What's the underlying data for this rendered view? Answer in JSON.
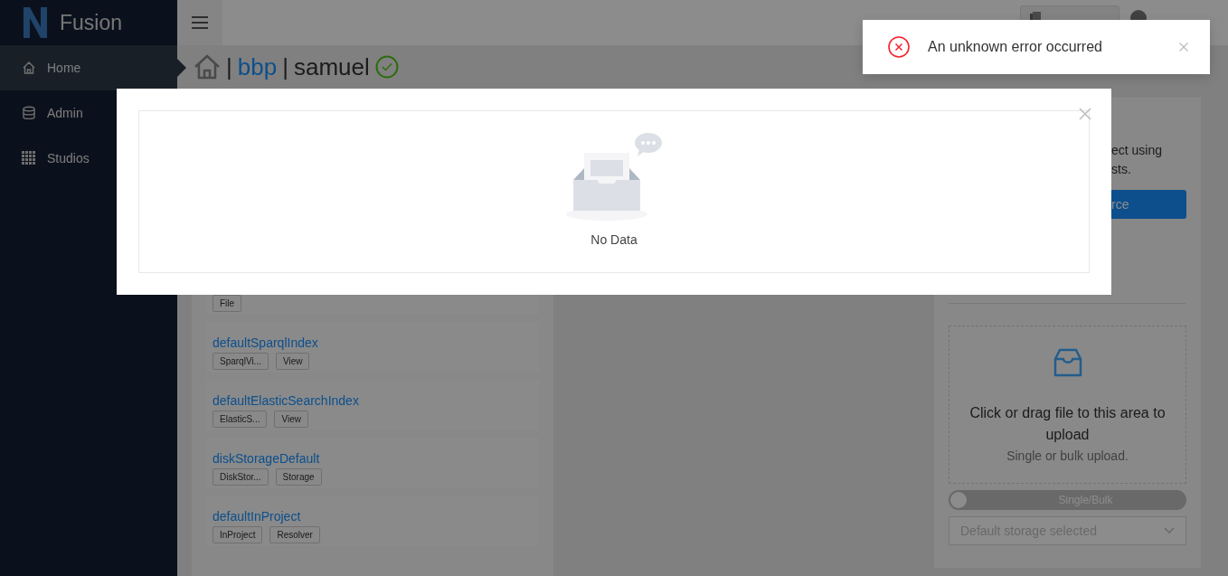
{
  "sidebar": {
    "app_name": "Fusion",
    "items": [
      {
        "label": "Home",
        "selected": true
      },
      {
        "label": "Admin",
        "selected": false
      },
      {
        "label": "Studios",
        "selected": false
      }
    ]
  },
  "breadcrumb": {
    "segments": [
      {
        "kind": "home"
      },
      {
        "kind": "separator",
        "text": "|"
      },
      {
        "kind": "link",
        "text": "bbp"
      },
      {
        "kind": "separator",
        "text": "|"
      },
      {
        "kind": "current",
        "text": "samuel"
      }
    ],
    "verified": true
  },
  "resources": [
    {
      "tags": [
        "File"
      ]
    },
    {
      "title": "defaultSparqlIndex",
      "tags": [
        "SparqlVi...",
        "View"
      ]
    },
    {
      "title": "defaultElasticSearchIndex",
      "tags": [
        "ElasticS...",
        "View"
      ]
    },
    {
      "title": "diskStorageDefault",
      "tags": [
        "DiskStor...",
        "Storage"
      ]
    },
    {
      "title": "defaultInProject",
      "tags": [
        "InProject",
        "Resolver"
      ]
    }
  ],
  "side_panel": {
    "text_lines": [
      "ect using",
      "sts."
    ],
    "button": "rce",
    "upload": {
      "title": "Click or drag file to this area to upload",
      "hint": "Single or bulk upload."
    },
    "bulk_switch": {
      "label": "Single/Bulk",
      "on": false
    },
    "storage_select": {
      "placeholder": "Default storage selected"
    }
  },
  "modal": {
    "empty_text": "No Data"
  },
  "toast": {
    "kind": "error",
    "message": "An unknown error occurred"
  }
}
